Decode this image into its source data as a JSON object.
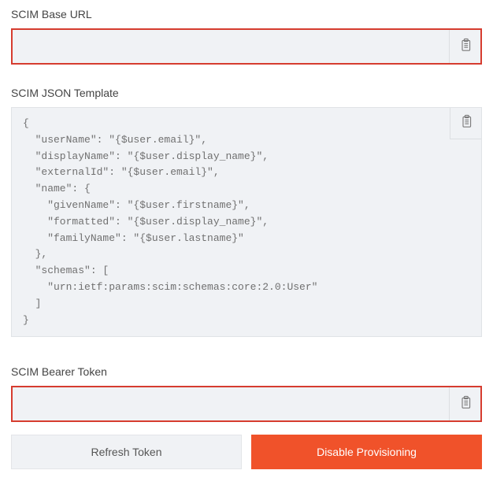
{
  "base_url": {
    "label": "SCIM Base URL",
    "value": ""
  },
  "json_template": {
    "label": "SCIM JSON Template",
    "code": "{\n  \"userName\": \"{$user.email}\",\n  \"displayName\": \"{$user.display_name}\",\n  \"externalId\": \"{$user.email}\",\n  \"name\": {\n    \"givenName\": \"{$user.firstname}\",\n    \"formatted\": \"{$user.display_name}\",\n    \"familyName\": \"{$user.lastname}\"\n  },\n  \"schemas\": [\n    \"urn:ietf:params:scim:schemas:core:2.0:User\"\n  ]\n}"
  },
  "bearer_token": {
    "label": "SCIM Bearer Token",
    "value": ""
  },
  "buttons": {
    "refresh": "Refresh Token",
    "disable": "Disable Provisioning"
  }
}
